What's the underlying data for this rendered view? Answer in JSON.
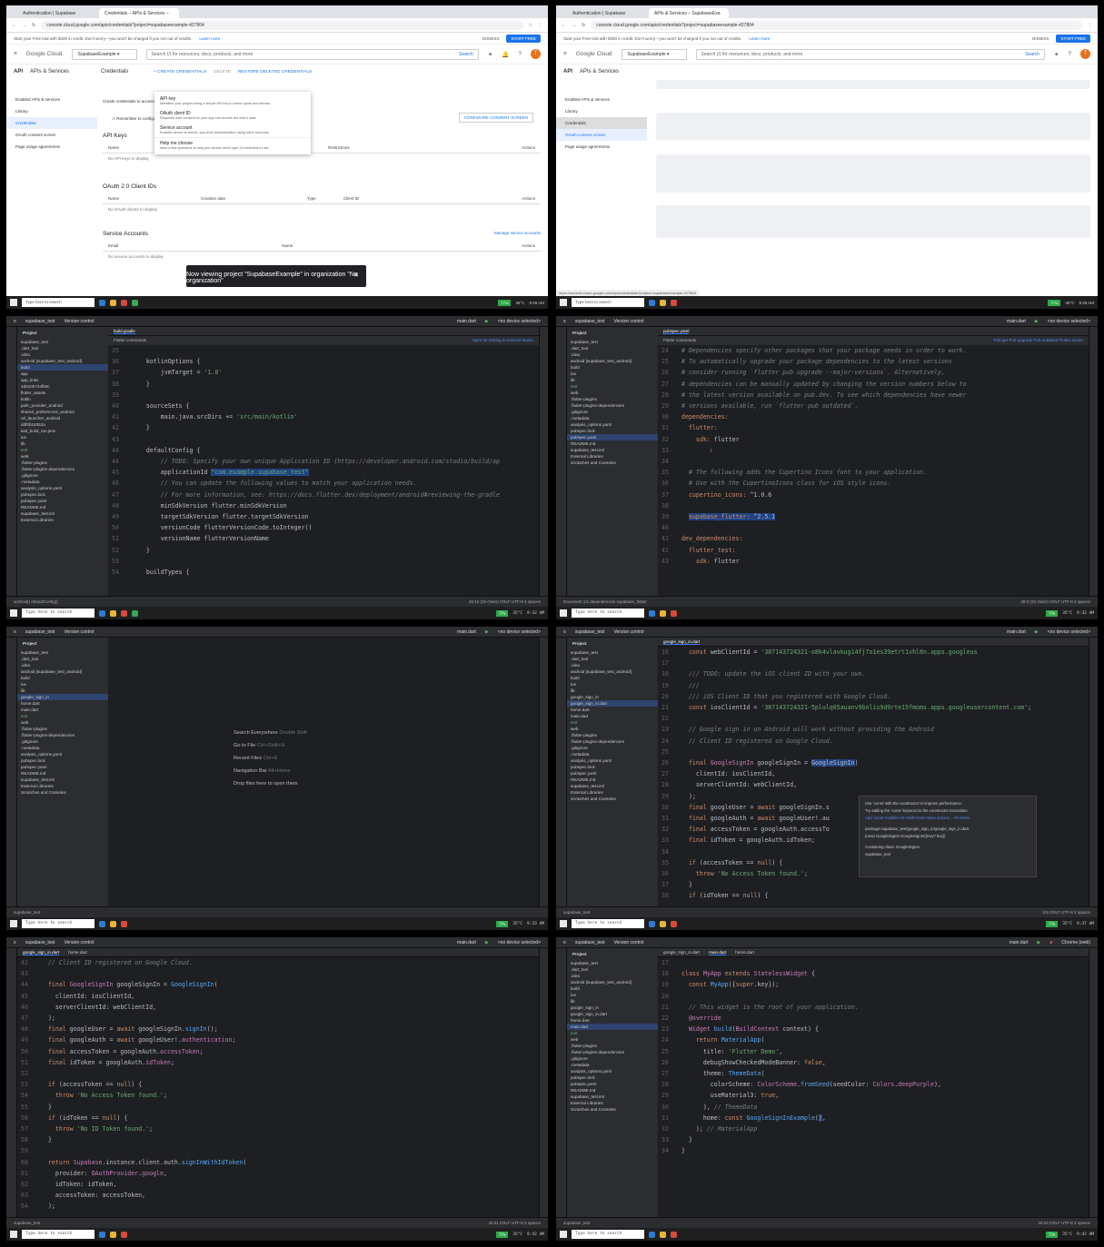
{
  "browser": {
    "tab1": "Authentication | Supabase",
    "tab2": "Credentials – APIs & Services –",
    "tab2b": "APIs & Services – SupabaseExa",
    "url1": "console.cloud.google.com/apis/credentials?project=supabaseexample-427804",
    "url2": "console.cloud.google.com/apis/credentials?project=supabaseexample-427804",
    "promo": "Start your Free trial with $300 in credit. Don't worry—you won't be charged if you run out of credits.",
    "learn": "Learn more",
    "dismiss": "DISMISS",
    "start_free": "START FREE",
    "logo": "Google Cloud",
    "project": "SupabaseExample",
    "search_placeholder": "Search (/) for resources, docs, products, and more",
    "search_btn": "Search",
    "avatar": "T",
    "api_label": "API",
    "apis_services": "APIs & Services",
    "credentials_title": "Credentials",
    "create_credentials": "+ CREATE CREDENTIALS",
    "delete": "DELETE",
    "restore": "RESTORE DELETED CREDENTIALS",
    "status_url": "https://console.cloud.google.com/apis/credentials?project=supabaseexample-427804"
  },
  "sidebar": [
    "Enabled APIs & services",
    "Library",
    "Credentials",
    "OAuth consent screen",
    "Page usage agreements"
  ],
  "menu": [
    {
      "title": "API key",
      "desc": "Identifies your project using a simple API key to check quota and access"
    },
    {
      "title": "OAuth client ID",
      "desc": "Requests user consent so your app can access the user's data"
    },
    {
      "title": "Service account",
      "desc": "Enables server-to-server, app-level authentication using robot accounts"
    },
    {
      "title": "Help me choose",
      "desc": "Asks a few questions to help you decide which type of credential to use"
    }
  ],
  "content": {
    "intro": "Create credentials to access your enabled APIs.",
    "remember": "Remember to configure the OAuth consent screen with information about your application.",
    "configure": "CONFIGURE CONSENT SCREEN",
    "api_keys": "API Keys",
    "api_cols": [
      "Name",
      "Restrictions",
      "Actions"
    ],
    "api_empty": "No API keys to display",
    "oauth": "OAuth 2.0 Client IDs",
    "oauth_cols": [
      "Name",
      "Creation date",
      "Type",
      "Client ID",
      "Actions"
    ],
    "oauth_empty": "No OAuth clients to display",
    "sa": "Service Accounts",
    "manage_sa": "Manage service accounts",
    "sa_cols": [
      "Email",
      "Name",
      "Actions"
    ],
    "sa_empty": "No service accounts to display",
    "toast": "Now viewing project \"SupabaseExample\" in organization \"No organization\""
  },
  "taskbar": {
    "search": "Type here to search",
    "temp": "35°C",
    "t1": "9:28 AM",
    "t2": "9:32 AM",
    "t3": "9:33 AM",
    "t4": "9:37 AM",
    "t5": "9:42 AM",
    "batt": "77%"
  },
  "ide": {
    "project": "supabase_test",
    "vcs": "Version control",
    "device": "<no device selected>",
    "device2": "Chrome (web)",
    "run_cfg": "main.dart",
    "project_label": "Project",
    "tab_gradle": "build.gradle",
    "tab_pubspec": "pubspec.yaml",
    "tab_gsi": "google_sign_in.dart",
    "tab_home": "home.dart",
    "tab_main": "main.dart",
    "flutter_cmds": "Flutter commands",
    "open_android": "Open for Editing in Android Studio",
    "pub_actions": "Pub get   Pub upgrade   Pub outdated   Flutter doctor",
    "status_gradle": "45:16 (25 chars)   CRLF   UTF-8   4 spaces",
    "status_pubspec": "38:3 (22 chars)   CRLF   UTF-8   2 spaces",
    "status_gsi": "5:8   CRLF   UTF-8   2 spaces",
    "status_gsi2": "46:31   CRLF   UTF-8   2 spaces",
    "status_main": "30:24   CRLF   UTF-8   2 spaces",
    "crumb_gradle": "android()   defaultConfig{}",
    "crumb_pubspec": "Document 1/1   dependencies   supabase_flutter",
    "welcome": [
      "Search Everywhere",
      "Go to File",
      "Recent Files",
      "Navigation Bar",
      "Drop files here to open them"
    ],
    "welcome_keys": [
      "Double Shift",
      "Ctrl+Shift+N",
      "Ctrl+E",
      "Alt+Home",
      ""
    ],
    "popup": [
      "Use 'const' with the constructor to improve performance.",
      "Try adding the 'const' keyword to the constructor invocation.",
      "Add 'const' modifier   Alt+Shift+Enter   More actions...   Alt+Enter",
      "package:supabase_test/google_sign_in/google_sign_in.dart",
      "(new) GoogleSignIn GoogleSignIn({Key? key})",
      "Containing class: GoogleSignIn",
      "supabase_test"
    ],
    "tree1": [
      "supabase_test",
      "  .dart_tool",
      "  .idea",
      "  android [supabase_test_android]",
      "  build",
      "    app",
      "    app_links",
      "    4d0100744fb9c",
      "    flutter_assets",
      "    kotlin",
      "    path_provider_android",
      "    shared_preferences_android",
      "    url_launcher_android",
      "    ddf0b16352a",
      "    last_build_run.json",
      "  ios",
      "  lib",
      "  test",
      "  web",
      "  .flutter-plugins",
      "  .flutter-plugins-dependencies",
      "  .gitignore",
      "  .metadata",
      "  analysis_options.yaml",
      "  pubspec.lock",
      "  pubspec.yaml",
      "  README.md",
      "  supabase_test.iml",
      "External Libraries",
      "Scratches and Consoles"
    ],
    "tree2": [
      "supabase_test",
      "  .dart_tool",
      "  .idea",
      "  android [supabase_test_android]",
      "  build",
      "  ios",
      "  lib",
      "    google_sign_in",
      "      google_sign_in.dart",
      "    home.dart",
      "    main.dart",
      "  test",
      "  web",
      "  .flutter-plugins",
      "  .flutter-plugins-dependencies",
      "  .gitignore",
      "  .metadata",
      "  analysis_options.yaml",
      "  pubspec.lock",
      "  pubspec.yaml",
      "  README.md",
      "  supabase_test.iml",
      "External Libraries",
      "Scratches and Consoles"
    ]
  }
}
